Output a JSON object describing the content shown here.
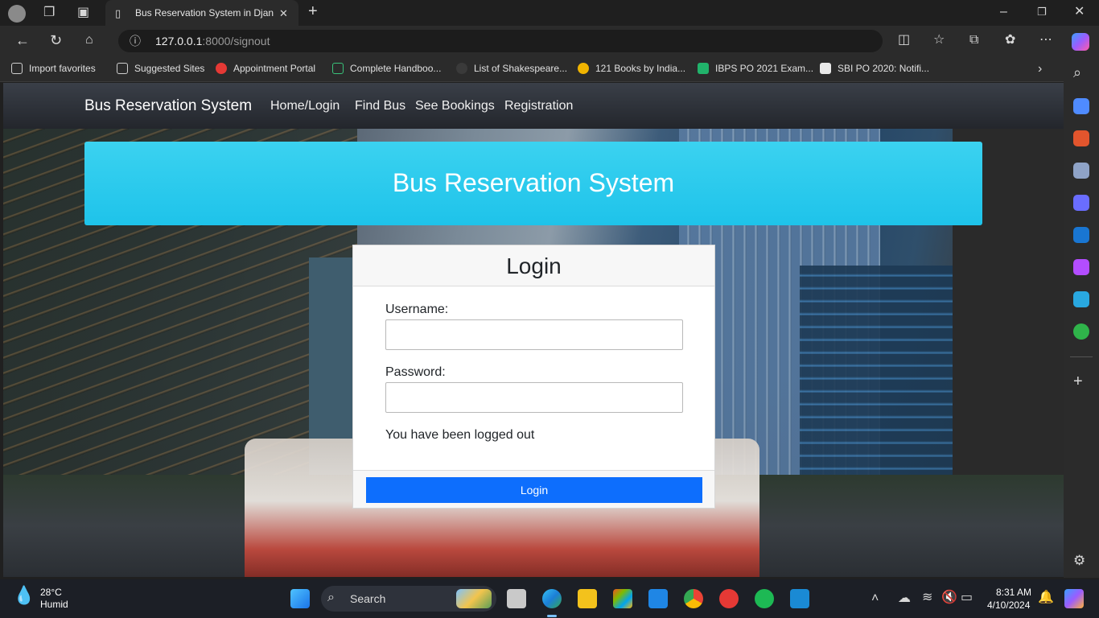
{
  "browser": {
    "tab_title": "Bus Reservation System in Django",
    "url_host": "127.0.0.1",
    "url_rest": ":8000/signout",
    "bookmarks": [
      "Import favorites",
      "Suggested Sites",
      "Appointment Portal",
      "Complete Handboo...",
      "List of Shakespeare...",
      "121 Books by India...",
      "IBPS PO 2021 Exam...",
      "SBI PO 2020: Notifi..."
    ]
  },
  "nav": {
    "brand": "Bus Reservation System",
    "links": [
      "Home/Login",
      "Find Bus",
      "See Bookings",
      "Registration"
    ]
  },
  "banner": {
    "title": "Bus Reservation System"
  },
  "login": {
    "title": "Login",
    "username_label": "Username:",
    "username_value": "",
    "password_label": "Password:",
    "password_value": "",
    "message": "You have been logged out",
    "button": "Login"
  },
  "taskbar": {
    "weather_temp": "28°C",
    "weather_desc": "Humid",
    "search_placeholder": "Search",
    "time": "8:31 AM",
    "date": "4/10/2024"
  },
  "colors": {
    "banner": "#1ec3ea",
    "login_button": "#0d6efd",
    "navbar": "#23262c"
  }
}
